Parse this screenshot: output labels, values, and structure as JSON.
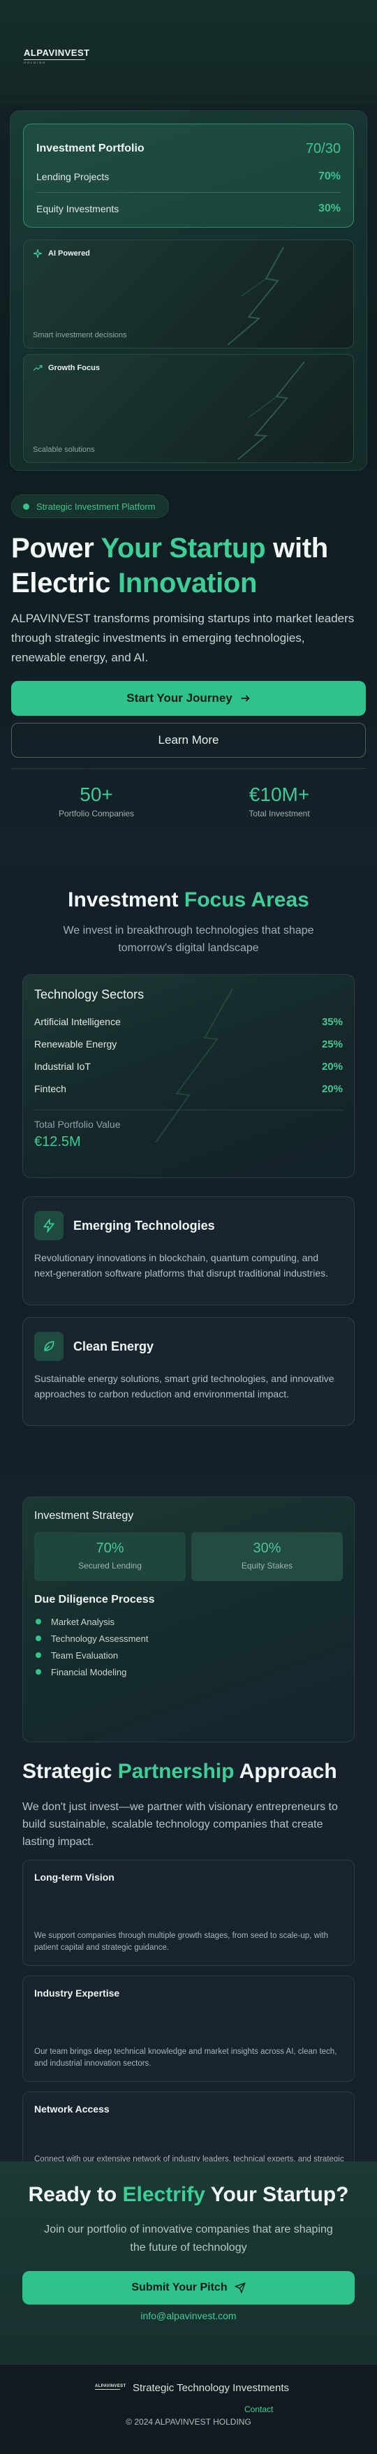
{
  "header": {
    "logo_text": "ALPAVINVEST",
    "logo_sub": "HOLDING"
  },
  "portfolio_card": {
    "title": "Investment Portfolio",
    "ratio": "70/30",
    "rows": [
      {
        "label": "Lending Projects",
        "value": "70%"
      },
      {
        "label": "Equity Investments",
        "value": "30%"
      }
    ]
  },
  "tiles": [
    {
      "label": "AI Powered",
      "icon": "sparkle-icon",
      "footer": "Smart investment decisions"
    },
    {
      "label": "Growth Focus",
      "icon": "trending-up-icon",
      "footer": "Scalable solutions"
    }
  ],
  "hero": {
    "badge": "Strategic Investment Platform",
    "title_part1": "Power ",
    "title_accent1": "Your Startup",
    "title_part2": " with ",
    "title_part3": "Electric ",
    "title_accent2": "Innovation",
    "description": "ALPAVINVEST transforms promising startups into market leaders through strategic investments in emerging technologies, renewable energy, and AI.",
    "primary_button": "Start Your Journey",
    "secondary_button": "Learn More",
    "stats": [
      {
        "value": "50+",
        "label": "Portfolio Companies"
      },
      {
        "value": "€10M+",
        "label": "Total Investment"
      }
    ]
  },
  "focus": {
    "title_part": "Investment ",
    "title_accent": "Focus Areas",
    "subtitle": "We invest in breakthrough technologies that shape tomorrow's digital landscape",
    "tech_card": {
      "title": "Technology Sectors",
      "rows": [
        {
          "label": "Artificial Intelligence",
          "value": "35%"
        },
        {
          "label": "Renewable Energy",
          "value": "25%"
        },
        {
          "label": "Industrial IoT",
          "value": "20%"
        },
        {
          "label": "Fintech",
          "value": "20%"
        }
      ],
      "total_label": "Total Portfolio Value",
      "total_value": "€12.5M"
    },
    "cards": [
      {
        "title": "Emerging Technologies",
        "icon": "bolt-icon",
        "text": "Revolutionary innovations in blockchain, quantum computing, and next-generation software platforms that disrupt traditional industries."
      },
      {
        "title": "Clean Energy",
        "icon": "leaf-icon",
        "text": "Sustainable energy solutions, smart grid technologies, and innovative approaches to carbon reduction and environmental impact."
      }
    ]
  },
  "strategy": {
    "title": "Investment Strategy",
    "boxes": [
      {
        "value": "70%",
        "label": "Secured Lending"
      },
      {
        "value": "30%",
        "label": "Equity Stakes"
      }
    ],
    "dd_title": "Due Diligence Process",
    "dd_items": [
      "Market Analysis",
      "Technology Assessment",
      "Team Evaluation",
      "Financial Modeling"
    ]
  },
  "partnership": {
    "title_part1": "Strategic ",
    "title_accent": "Partnership",
    "title_part2": " Approach",
    "description": "We don't just invest—we partner with visionary entrepreneurs to build sustainable, scalable technology companies that create lasting impact.",
    "cards": [
      {
        "title": "Long-term Vision",
        "text": "We support companies through multiple growth stages, from seed to scale-up, with patient capital and strategic guidance."
      },
      {
        "title": "Industry Expertise",
        "text": "Our team brings deep technical knowledge and market insights across AI, clean tech, and industrial innovation sectors."
      },
      {
        "title": "Network Access",
        "text": "Connect with our extensive network of industry leaders, technical experts, and strategic partners to accelerate growth."
      }
    ]
  },
  "cta": {
    "title_part1": "Ready to ",
    "title_accent": "Electrify",
    "title_part2": " Your Startup?",
    "subtitle": "Join our portfolio of innovative companies that are shaping the future of technology",
    "button": "Submit Your Pitch",
    "email": "info@alpavinvest.com"
  },
  "footer": {
    "logo_text": "ALPAVINVEST",
    "tagline": "Strategic Technology Investments",
    "contact": "Contact",
    "copyright": "© 2024 ALPAVINVEST HOLDING"
  },
  "colors": {
    "accent": "#3ecf97",
    "button": "#2fc28b",
    "background": "#0f1a1d"
  }
}
